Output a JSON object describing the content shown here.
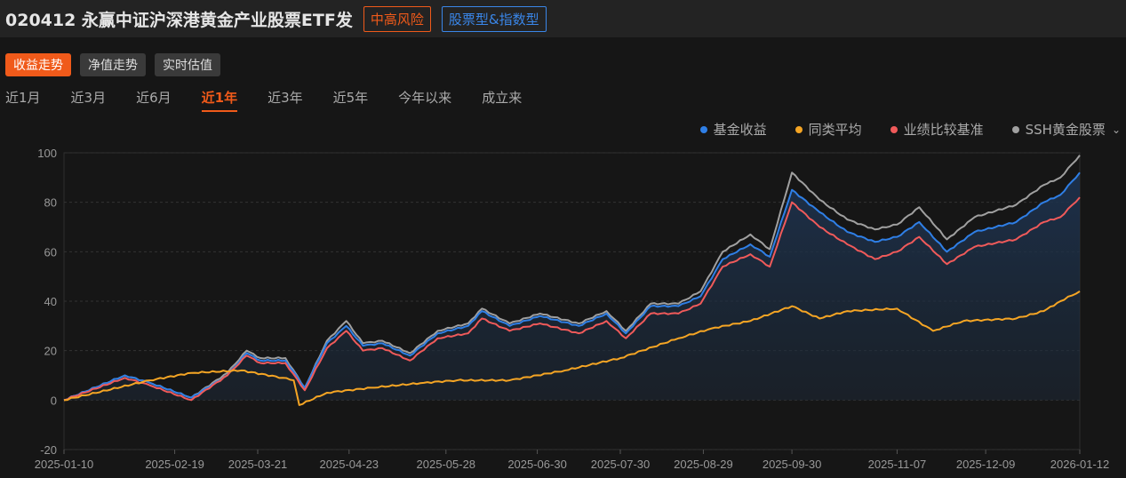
{
  "header": {
    "title": "020412  永赢中证沪深港黄金产业股票ETF发",
    "risk": "中高风险",
    "type": "股票型&指数型"
  },
  "modes": [
    "收益走势",
    "净值走势",
    "实时估值"
  ],
  "active_mode": 0,
  "ranges": [
    "近1月",
    "近3月",
    "近6月",
    "近1年",
    "近3年",
    "近5年",
    "今年以来",
    "成立来"
  ],
  "active_range": 3,
  "legend_dropdown_icon": "chevron-down-icon",
  "chart_data": {
    "type": "line",
    "ylim": [
      -20,
      100
    ],
    "yticks": [
      "100",
      "80",
      "60",
      "40",
      "20",
      "0",
      "-20"
    ],
    "xticks": [
      "2025-01-10",
      "2025-02-19",
      "2025-03-21",
      "2025-04-23",
      "2025-05-28",
      "2025-06-30",
      "2025-07-30",
      "2025-08-29",
      "2025-09-30",
      "2025-11-07",
      "2025-12-09",
      "2026-01-12"
    ],
    "xlim": [
      "2025-01-10",
      "2026-01-12"
    ],
    "grid": "horizontal dashed",
    "legend_position": "top-right",
    "series": [
      {
        "name": "SSH黄金股票",
        "color": "#a0a0a0",
        "points": [
          [
            "2025-01-10",
            0
          ],
          [
            "2025-02-01",
            10
          ],
          [
            "2025-02-10",
            7
          ],
          [
            "2025-02-25",
            1
          ],
          [
            "2025-03-10",
            11
          ],
          [
            "2025-03-17",
            20
          ],
          [
            "2025-03-22",
            17
          ],
          [
            "2025-03-31",
            17
          ],
          [
            "2025-04-07",
            5
          ],
          [
            "2025-04-15",
            24
          ],
          [
            "2025-04-22",
            32
          ],
          [
            "2025-04-28",
            23
          ],
          [
            "2025-05-05",
            24
          ],
          [
            "2025-05-15",
            19
          ],
          [
            "2025-05-25",
            28
          ],
          [
            "2025-06-05",
            31
          ],
          [
            "2025-06-10",
            37
          ],
          [
            "2025-06-20",
            31
          ],
          [
            "2025-07-01",
            35
          ],
          [
            "2025-07-15",
            31
          ],
          [
            "2025-07-25",
            36
          ],
          [
            "2025-08-01",
            28
          ],
          [
            "2025-08-10",
            39
          ],
          [
            "2025-08-20",
            39
          ],
          [
            "2025-08-28",
            44
          ],
          [
            "2025-09-05",
            60
          ],
          [
            "2025-09-15",
            67
          ],
          [
            "2025-09-22",
            61
          ],
          [
            "2025-09-30",
            92
          ],
          [
            "2025-10-10",
            81
          ],
          [
            "2025-10-20",
            73
          ],
          [
            "2025-10-30",
            69
          ],
          [
            "2025-11-07",
            71
          ],
          [
            "2025-11-15",
            78
          ],
          [
            "2025-11-25",
            65
          ],
          [
            "2025-12-05",
            74
          ],
          [
            "2025-12-20",
            79
          ],
          [
            "2025-12-30",
            87
          ],
          [
            "2026-01-05",
            90
          ],
          [
            "2026-01-12",
            99
          ]
        ]
      },
      {
        "name": "基金收益",
        "color": "#2f7fe6",
        "points": [
          [
            "2025-01-10",
            0
          ],
          [
            "2025-02-01",
            10
          ],
          [
            "2025-02-10",
            7
          ],
          [
            "2025-02-25",
            1
          ],
          [
            "2025-03-10",
            10
          ],
          [
            "2025-03-17",
            19
          ],
          [
            "2025-03-22",
            16
          ],
          [
            "2025-03-31",
            16
          ],
          [
            "2025-04-07",
            5
          ],
          [
            "2025-04-15",
            23
          ],
          [
            "2025-04-22",
            30
          ],
          [
            "2025-04-28",
            22
          ],
          [
            "2025-05-05",
            23
          ],
          [
            "2025-05-15",
            18
          ],
          [
            "2025-05-25",
            27
          ],
          [
            "2025-06-05",
            30
          ],
          [
            "2025-06-10",
            36
          ],
          [
            "2025-06-20",
            30
          ],
          [
            "2025-07-01",
            34
          ],
          [
            "2025-07-15",
            30
          ],
          [
            "2025-07-25",
            35
          ],
          [
            "2025-08-01",
            27
          ],
          [
            "2025-08-10",
            38
          ],
          [
            "2025-08-20",
            38
          ],
          [
            "2025-08-28",
            42
          ],
          [
            "2025-09-05",
            57
          ],
          [
            "2025-09-15",
            63
          ],
          [
            "2025-09-22",
            58
          ],
          [
            "2025-09-30",
            85
          ],
          [
            "2025-10-10",
            76
          ],
          [
            "2025-10-20",
            68
          ],
          [
            "2025-10-30",
            64
          ],
          [
            "2025-11-07",
            66
          ],
          [
            "2025-11-15",
            72
          ],
          [
            "2025-11-25",
            60
          ],
          [
            "2025-12-05",
            68
          ],
          [
            "2025-12-20",
            72
          ],
          [
            "2025-12-30",
            80
          ],
          [
            "2026-01-05",
            83
          ],
          [
            "2026-01-12",
            92
          ]
        ]
      },
      {
        "name": "业绩比较基准",
        "color": "#f05a5a",
        "points": [
          [
            "2025-01-10",
            0
          ],
          [
            "2025-02-01",
            9
          ],
          [
            "2025-02-10",
            6
          ],
          [
            "2025-02-25",
            0
          ],
          [
            "2025-03-10",
            10
          ],
          [
            "2025-03-17",
            18
          ],
          [
            "2025-03-22",
            15
          ],
          [
            "2025-03-31",
            15
          ],
          [
            "2025-04-07",
            4
          ],
          [
            "2025-04-15",
            21
          ],
          [
            "2025-04-22",
            28
          ],
          [
            "2025-04-28",
            20
          ],
          [
            "2025-05-05",
            21
          ],
          [
            "2025-05-15",
            16
          ],
          [
            "2025-05-25",
            25
          ],
          [
            "2025-06-05",
            27
          ],
          [
            "2025-06-10",
            33
          ],
          [
            "2025-06-20",
            28
          ],
          [
            "2025-07-01",
            31
          ],
          [
            "2025-07-15",
            27
          ],
          [
            "2025-07-25",
            32
          ],
          [
            "2025-08-01",
            25
          ],
          [
            "2025-08-10",
            35
          ],
          [
            "2025-08-20",
            35
          ],
          [
            "2025-08-28",
            39
          ],
          [
            "2025-09-05",
            54
          ],
          [
            "2025-09-15",
            59
          ],
          [
            "2025-09-22",
            54
          ],
          [
            "2025-09-30",
            80
          ],
          [
            "2025-10-10",
            70
          ],
          [
            "2025-10-20",
            63
          ],
          [
            "2025-10-30",
            57
          ],
          [
            "2025-11-07",
            60
          ],
          [
            "2025-11-15",
            66
          ],
          [
            "2025-11-25",
            55
          ],
          [
            "2025-12-05",
            62
          ],
          [
            "2025-12-20",
            65
          ],
          [
            "2025-12-30",
            72
          ],
          [
            "2026-01-05",
            74
          ],
          [
            "2026-01-12",
            82
          ]
        ]
      },
      {
        "name": "同类平均",
        "color": "#f5a524",
        "points": [
          [
            "2025-01-10",
            0
          ],
          [
            "2025-02-10",
            8
          ],
          [
            "2025-02-25",
            11
          ],
          [
            "2025-03-15",
            12
          ],
          [
            "2025-03-30",
            9
          ],
          [
            "2025-04-03",
            8
          ],
          [
            "2025-04-05",
            -2
          ],
          [
            "2025-04-15",
            3
          ],
          [
            "2025-05-01",
            5
          ],
          [
            "2025-05-20",
            7
          ],
          [
            "2025-06-01",
            8
          ],
          [
            "2025-06-20",
            8
          ],
          [
            "2025-07-10",
            12
          ],
          [
            "2025-07-30",
            17
          ],
          [
            "2025-08-20",
            25
          ],
          [
            "2025-09-01",
            29
          ],
          [
            "2025-09-15",
            32
          ],
          [
            "2025-09-30",
            38
          ],
          [
            "2025-10-10",
            33
          ],
          [
            "2025-10-20",
            36
          ],
          [
            "2025-11-07",
            37
          ],
          [
            "2025-11-20",
            28
          ],
          [
            "2025-12-01",
            32
          ],
          [
            "2025-12-20",
            33
          ],
          [
            "2025-12-30",
            36
          ],
          [
            "2026-01-05",
            40
          ],
          [
            "2026-01-12",
            44
          ]
        ]
      }
    ],
    "legend_order": [
      "基金收益",
      "同类平均",
      "业绩比较基准",
      "SSH黄金股票"
    ]
  }
}
